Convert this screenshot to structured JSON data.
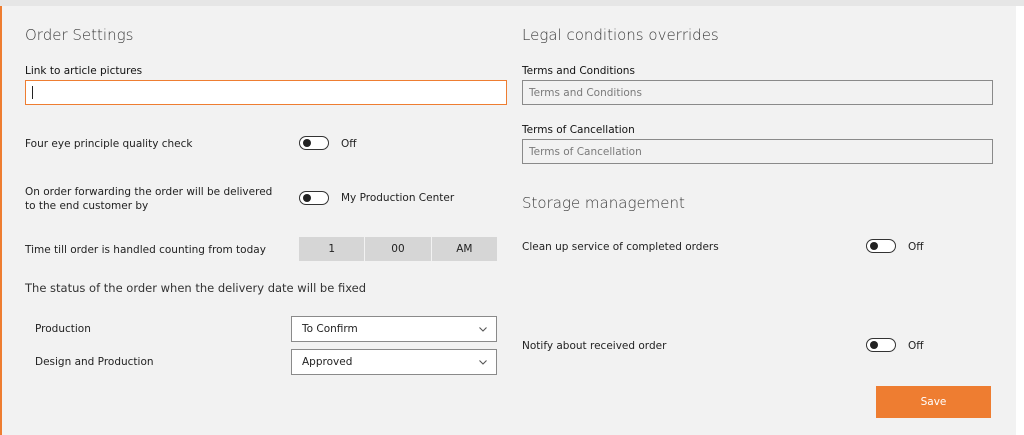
{
  "order_settings": {
    "title": "Order Settings",
    "article_link": {
      "label": "Link to article pictures",
      "value": ""
    },
    "four_eye": {
      "label": "Four eye principle quality check",
      "state": "Off"
    },
    "forwarding": {
      "label_line1": "On order forwarding the order will be delivered",
      "label_line2": "to the end customer by",
      "state": "My Production Center"
    },
    "time_till": {
      "label": "Time till order is handled counting from today",
      "hour": "1",
      "minute": "00",
      "period": "AM"
    },
    "status_heading": "The status of the order when the delivery date will be fixed",
    "production": {
      "label": "Production",
      "selected": "To Confirm"
    },
    "design_production": {
      "label": "Design and Production",
      "selected": "Approved"
    }
  },
  "legal": {
    "title": "Legal conditions overrides",
    "terms": {
      "label": "Terms and Conditions",
      "placeholder": "Terms and Conditions"
    },
    "cancellation": {
      "label": "Terms of Cancellation",
      "placeholder": "Terms of Cancellation"
    }
  },
  "storage": {
    "title": "Storage management",
    "cleanup": {
      "label": "Clean up service of completed orders",
      "state": "Off"
    },
    "notify": {
      "label": "Notify about received order",
      "state": "Off"
    }
  },
  "save_label": "Save",
  "colors": {
    "accent": "#ee7d31",
    "panel_bg": "#f2f2f2"
  },
  "toggle_states": {
    "four_eye": false,
    "forwarding": false,
    "cleanup": false,
    "notify": false
  }
}
